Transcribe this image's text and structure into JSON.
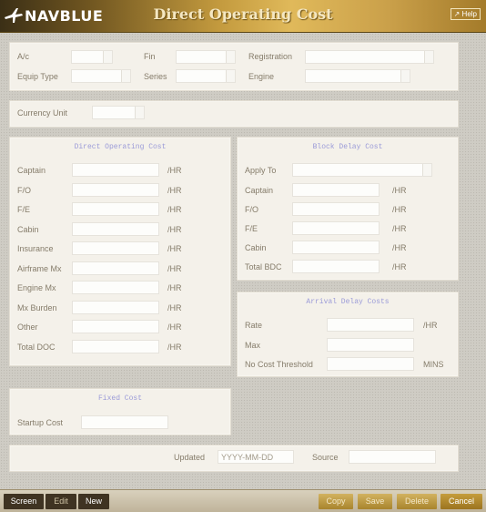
{
  "header": {
    "brand": "NAVBLUE",
    "title": "Direct Operating Cost",
    "help_label": "Help"
  },
  "icons": {
    "brand_mark": "plane-icon",
    "help": "external-link-icon"
  },
  "top_panel": {
    "ac_label": "A/c",
    "fin_label": "Fin",
    "registration_label": "Registration",
    "equip_type_label": "Equip Type",
    "series_label": "Series",
    "engine_label": "Engine"
  },
  "currency": {
    "label": "Currency Unit"
  },
  "doc": {
    "title": "Direct Operating Cost",
    "rows": [
      {
        "label": "Captain",
        "unit": "/HR"
      },
      {
        "label": "F/O",
        "unit": "/HR"
      },
      {
        "label": "F/E",
        "unit": "/HR"
      },
      {
        "label": "Cabin",
        "unit": "/HR"
      },
      {
        "label": "Insurance",
        "unit": "/HR"
      },
      {
        "label": "Airframe Mx",
        "unit": "/HR"
      },
      {
        "label": "Engine Mx",
        "unit": "/HR"
      },
      {
        "label": "Mx Burden",
        "unit": "/HR"
      },
      {
        "label": "Other",
        "unit": "/HR"
      },
      {
        "label": "Total DOC",
        "unit": "/HR"
      }
    ]
  },
  "bdc": {
    "title": "Block Delay Cost",
    "apply_to_label": "Apply To",
    "rows": [
      {
        "label": "Captain",
        "unit": "/HR"
      },
      {
        "label": "F/O",
        "unit": "/HR"
      },
      {
        "label": "F/E",
        "unit": "/HR"
      },
      {
        "label": "Cabin",
        "unit": "/HR"
      },
      {
        "label": "Total BDC",
        "unit": "/HR"
      }
    ]
  },
  "arrival": {
    "title": "Arrival Delay Costs",
    "rate_label": "Rate",
    "rate_unit": "/HR",
    "max_label": "Max",
    "threshold_label": "No Cost Threshold",
    "threshold_unit": "MINS"
  },
  "fixed": {
    "title": "Fixed Cost",
    "startup_label": "Startup Cost"
  },
  "meta": {
    "updated_label": "Updated",
    "updated_placeholder": "YYYY-MM-DD",
    "source_label": "Source"
  },
  "footer": {
    "screen": "Screen",
    "edit": "Edit",
    "new": "New",
    "copy": "Copy",
    "save": "Save",
    "delete": "Delete",
    "cancel": "Cancel"
  }
}
